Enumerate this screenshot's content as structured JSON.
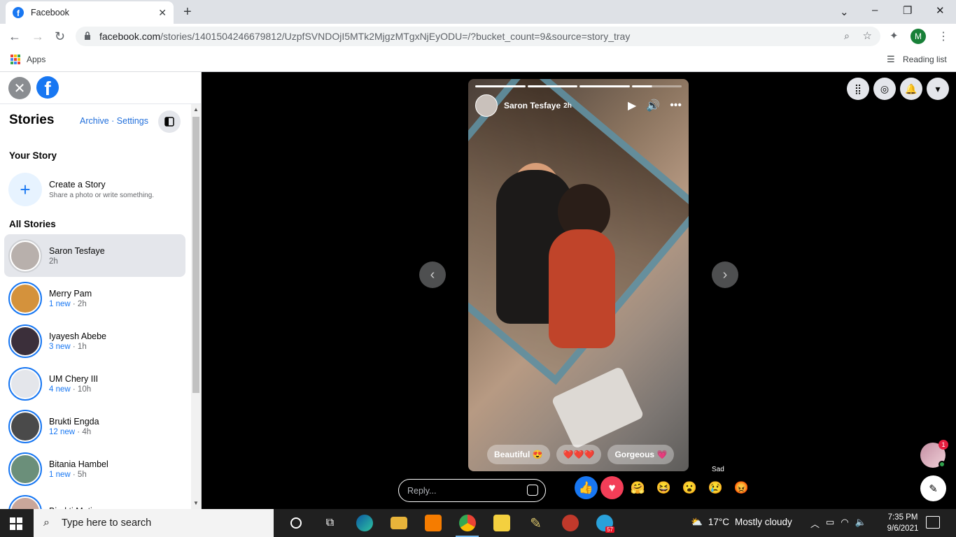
{
  "browser": {
    "tab_title": "Facebook",
    "url_main": "facebook.com",
    "url_rest": "/stories/1401504246679812/UzpfSVNDOjI5MTk2MjgzMTgxNjEyODU=/?bucket_count=9&source=story_tray",
    "apps_label": "Apps",
    "reading_list_label": "Reading list",
    "profile_initial": "M",
    "colors": {
      "tabbar": "#dee1e6",
      "omnibox": "#f1f3f4"
    }
  },
  "sidebar": {
    "title": "Stories",
    "archive_label": "Archive",
    "separator": " · ",
    "settings_label": "Settings",
    "your_story_heading": "Your Story",
    "create_title": "Create a Story",
    "create_subtitle": "Share a photo or write something.",
    "all_stories_heading": "All Stories",
    "stories": [
      {
        "name": "Saron Tesfaye",
        "new": "",
        "time": "2h",
        "active": true,
        "avatar_color": "#b8b0ac"
      },
      {
        "name": "Merry Pam",
        "new": "1 new",
        "time": "2h",
        "active": false,
        "avatar_color": "#d4923c"
      },
      {
        "name": "Iyayesh Abebe",
        "new": "3 new",
        "time": "1h",
        "active": false,
        "avatar_color": "#3b2f3a"
      },
      {
        "name": "UM Chery III",
        "new": "4 new",
        "time": "10h",
        "active": false,
        "avatar_color": "#e4e6eb"
      },
      {
        "name": "Brukti Engda",
        "new": "12 new",
        "time": "4h",
        "active": false,
        "avatar_color": "#4a4a4a"
      },
      {
        "name": "Bitania Hambel",
        "new": "1 new",
        "time": "5h",
        "active": false,
        "avatar_color": "#6b8f7a"
      },
      {
        "name": "Birukti Matiyas",
        "new": "",
        "time": "",
        "active": false,
        "avatar_color": "#c9a69a"
      }
    ]
  },
  "story": {
    "author": "Saron Tesfaye",
    "time": "2h",
    "progress_segments": [
      "done",
      "done",
      "done",
      "half"
    ],
    "quick_reactions": [
      "Beautiful 😍",
      "❤️❤️❤️",
      "Gorgeous 💗"
    ],
    "reply_placeholder": "Reply...",
    "reactions": [
      {
        "name": "like",
        "glyph": "👍",
        "bg": "#1877f2"
      },
      {
        "name": "love",
        "glyph": "♥",
        "bg": "#f33e58"
      },
      {
        "name": "care",
        "glyph": "🤗",
        "bg": "transparent"
      },
      {
        "name": "haha",
        "glyph": "😆",
        "bg": "transparent"
      },
      {
        "name": "wow",
        "glyph": "😮",
        "bg": "transparent"
      },
      {
        "name": "sad",
        "glyph": "😢",
        "bg": "transparent"
      },
      {
        "name": "angry",
        "glyph": "😡",
        "bg": "transparent"
      }
    ],
    "hover_label": "Sad",
    "chat_badge": "1"
  },
  "taskbar": {
    "search_placeholder": "Type here to search",
    "weather_temp": "17°C",
    "weather_text": "Mostly cloudy",
    "time": "7:35 PM",
    "date": "9/6/2021",
    "telegram_badge": "57"
  }
}
